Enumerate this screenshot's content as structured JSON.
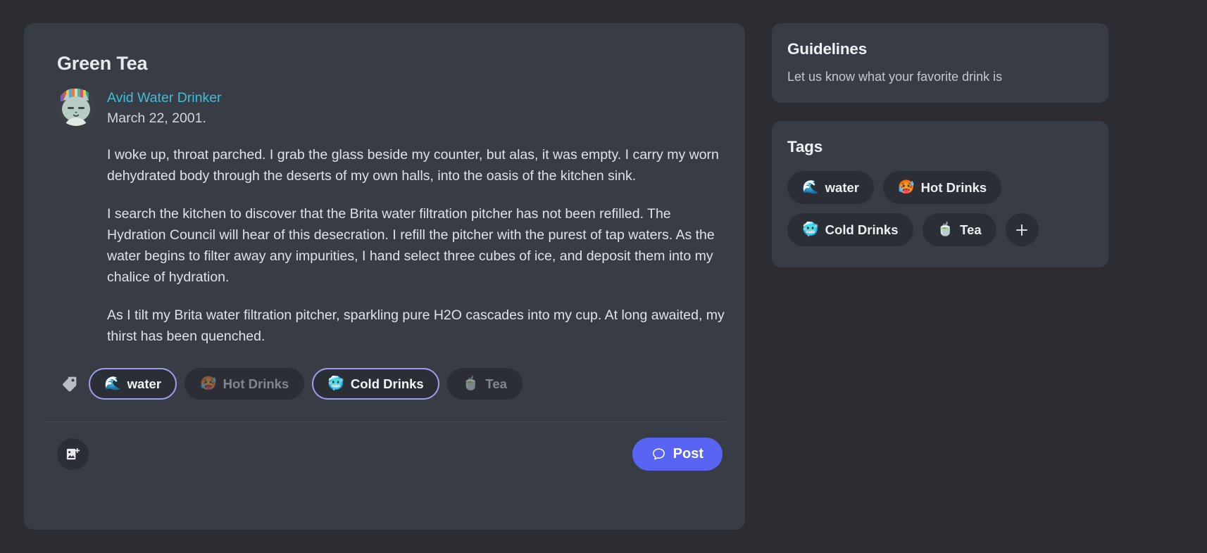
{
  "post": {
    "title": "Green Tea",
    "author": "Avid Water Drinker",
    "date": "March 22, 2001.",
    "avatar_alt": "pixel-cat-avatar",
    "paragraphs": [
      "I woke up, throat parched. I grab the glass beside my counter, but alas, it was empty. I carry my worn dehydrated body through the deserts of my own halls, into the oasis of the kitchen sink.",
      "I search the kitchen to discover that the Brita water filtration pitcher has not been refilled. The Hydration Council will hear of this desecration. I refill the pitcher with the purest of tap waters. As the water begins to filter away any impurities, I hand select three cubes of ice, and deposit them into my chalice of hydration.",
      "As I tilt my Brita water filtration pitcher, sparkling pure H2O cascades into my cup. At long awaited, my thirst has been quenched."
    ],
    "chips": [
      {
        "emoji": "🌊",
        "label": "water",
        "selected": true
      },
      {
        "emoji": "🥵",
        "label": "Hot Drinks",
        "selected": false
      },
      {
        "emoji": "🥶",
        "label": "Cold Drinks",
        "selected": true
      },
      {
        "emoji": "🍵",
        "label": "Tea",
        "selected": false
      }
    ],
    "footer": {
      "upload_icon": "add-image-icon",
      "post_label": "Post",
      "post_icon": "speech-bubble-icon"
    }
  },
  "guidelines": {
    "title": "Guidelines",
    "description": "Let us know what your favorite drink is"
  },
  "tags_panel": {
    "title": "Tags",
    "add_label": "+",
    "tags": [
      {
        "emoji": "🌊",
        "label": "water"
      },
      {
        "emoji": "🥵",
        "label": "Hot Drinks"
      },
      {
        "emoji": "🥶",
        "label": "Cold Drinks"
      },
      {
        "emoji": "🍵",
        "label": "Tea"
      }
    ]
  },
  "colors": {
    "page_bg": "#2b2d33",
    "card_bg": "#383c45",
    "chip_bg": "#2b2e35",
    "accent_selected": "#9d9ced",
    "accent_primary": "#5965f2",
    "author_link": "#3fbfd6"
  }
}
